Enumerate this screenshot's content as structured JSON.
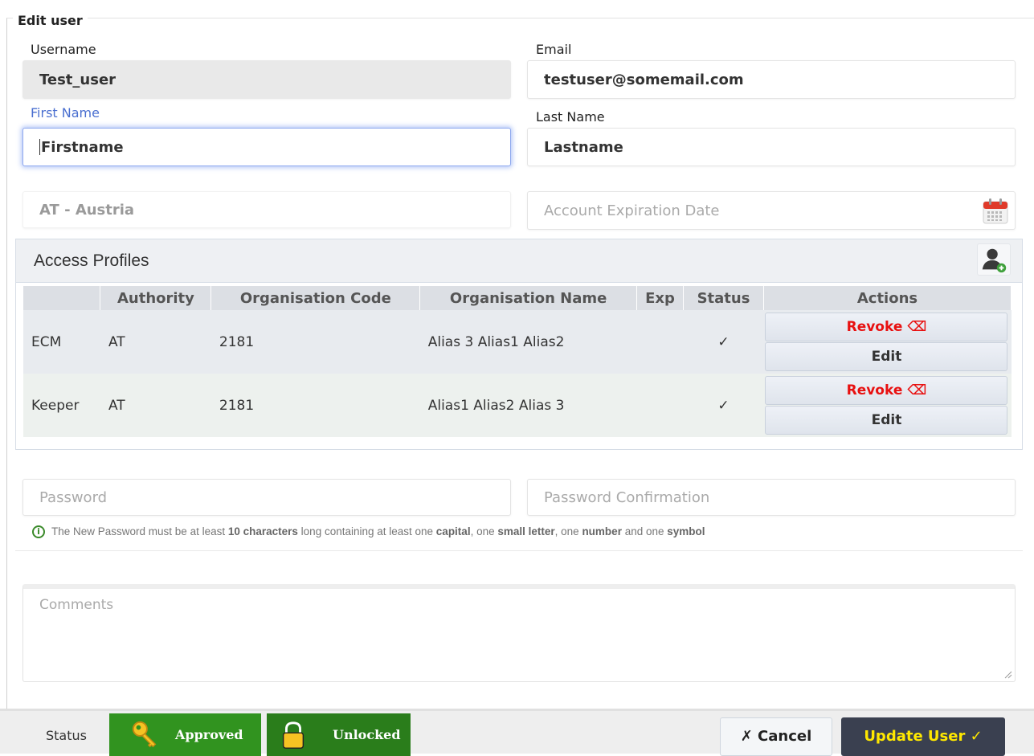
{
  "form": {
    "legend": "Edit user",
    "username_label": "Username",
    "username_value": "Test_user",
    "email_label": "Email",
    "email_value": "testuser@somemail.com",
    "firstname_label": "First Name",
    "firstname_value": "Firstname",
    "lastname_label": "Last Name",
    "lastname_value": "Lastname",
    "country_value": "AT - Austria",
    "expiration_placeholder": "Account Expiration Date",
    "password_placeholder": "Password",
    "password_confirm_placeholder": "Password Confirmation",
    "comments_placeholder": "Comments"
  },
  "access_profiles": {
    "title": "Access Profiles",
    "columns": [
      "",
      "Authority",
      "Organisation Code",
      "Organisation Name",
      "Exp",
      "Status",
      "Actions"
    ],
    "rows": [
      {
        "type": "ECM",
        "authority": "AT",
        "org_code": "2181",
        "org_name": "Alias 3 Alias1 Alias2",
        "exp": "",
        "status": "✓"
      },
      {
        "type": "Keeper",
        "authority": "AT",
        "org_code": "2181",
        "org_name": "Alias1 Alias2 Alias 3",
        "exp": "",
        "status": "✓"
      }
    ],
    "revoke_label": "Revoke ⌫",
    "edit_label": "Edit"
  },
  "hint": {
    "t1": "The New Password must be at least ",
    "b1": "10 characters",
    "t2": " long containing at least one ",
    "b2": "capital",
    "t3": ", one ",
    "b3": "small letter",
    "t4": ", one ",
    "b4": "number",
    "t5": " and one ",
    "b5": "symbol"
  },
  "footer": {
    "status_label": "Status",
    "approved_label": "Approved",
    "unlocked_label": "Unlocked",
    "cancel_label": "✗ Cancel",
    "update_label": "Update User ✓"
  },
  "colors": {
    "accent_focus": "#4a6fd0",
    "revoke": "#e81010",
    "status_green": "#31931f",
    "update_bg": "#3a4050",
    "update_text": "#ffe800"
  }
}
